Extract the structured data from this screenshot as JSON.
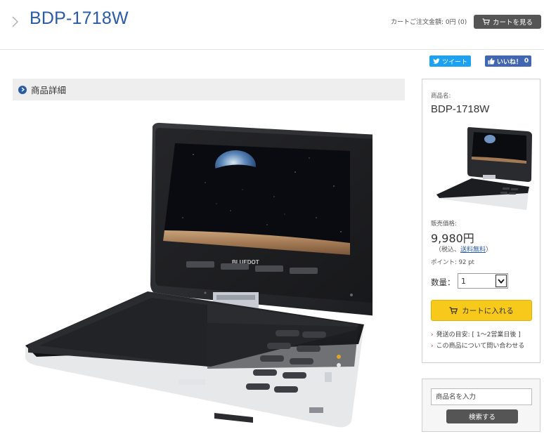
{
  "header": {
    "title": "BDP-1718W",
    "cart_summary": "カートご注文金額: 0円 (0)",
    "cart_button": "カートを見る"
  },
  "social": {
    "tweet": "ツイート",
    "like": "いいね！",
    "like_count": "0"
  },
  "section": {
    "title": "商品詳細"
  },
  "product_image": {
    "brand": "BLUEDOT"
  },
  "side": {
    "name_label": "商品名:",
    "name": "BDP-1718W",
    "price_label": "販売価格:",
    "price": "9,980円",
    "tax_prefix": "（税込、",
    "tax_link": "送料無料",
    "tax_suffix": "）",
    "points": "ポイント: 92 pt",
    "qty_label": "数量：",
    "qty_value": "1",
    "add_to_cart": "カートに入れる",
    "shipping": "発送の目安: [ 1〜2営業日後 ]",
    "inquiry": "この商品について問い合わせる"
  },
  "search": {
    "placeholder": "商品名を入力",
    "button": "検索する"
  },
  "colors": {
    "brand_blue": "#2a5ba8",
    "cart_yellow": "#f7c91a",
    "dark_button": "#555555",
    "twitter": "#1da1f2",
    "facebook": "#4267b2"
  }
}
